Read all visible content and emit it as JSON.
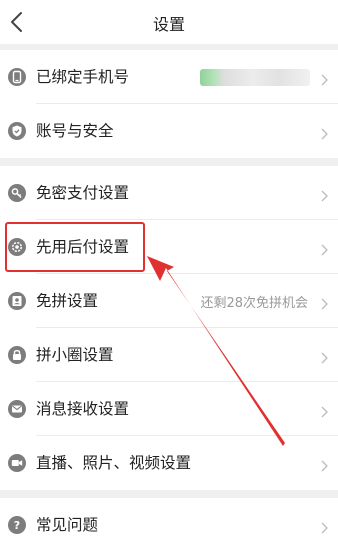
{
  "header": {
    "title": "设置"
  },
  "account": {
    "phone_label": "已绑定手机号",
    "security_label": "账号与安全"
  },
  "settings": {
    "password_free_pay": "免密支付设置",
    "pay_later": "先用后付设置",
    "free_group": "免拼设置",
    "free_group_remaining": "还剩28次免拼机会",
    "small_circle": "拼小圈设置",
    "message_receive": "消息接收设置",
    "live_photo_video": "直播、照片、视频设置"
  },
  "help": {
    "faq": "常见问题"
  },
  "colors": {
    "icon": "#7d7d7d",
    "highlight_red": "#e0302f",
    "background": "#f0f0f0"
  },
  "icons": [
    "back-icon",
    "phone-icon",
    "shield-icon",
    "key-icon",
    "gear-icon",
    "group-icon",
    "lock-icon",
    "message-icon",
    "video-icon",
    "question-icon",
    "chevron-right-icon"
  ]
}
